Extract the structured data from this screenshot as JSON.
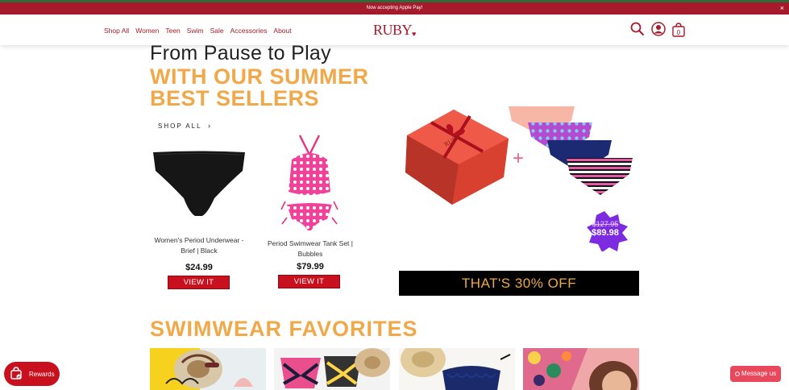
{
  "announcement": {
    "text": "Now accepting Apple Pay!",
    "close_icon": "×"
  },
  "nav": {
    "items": [
      {
        "label": "Shop All"
      },
      {
        "label": "Women"
      },
      {
        "label": "Teen"
      },
      {
        "label": "Swim"
      },
      {
        "label": "Sale"
      },
      {
        "label": "Accessories"
      },
      {
        "label": "About"
      }
    ]
  },
  "logo": {
    "text": "RUBY",
    "mark": "♥"
  },
  "cart": {
    "count": "0"
  },
  "hero": {
    "line1": "From Pause to Play",
    "line2": "WITH OUR SUMMER",
    "line3": "BEST SELLERS",
    "shop_all": "SHOP ALL",
    "chevron": "›"
  },
  "products": [
    {
      "name": "Women's Period Underwear - Brief | Black",
      "price": "$24.99",
      "button": "VIEW IT"
    },
    {
      "name": "Period Swimwear Tank Set | Bubbles",
      "price": "$79.99",
      "button": "VIEW IT"
    }
  ],
  "promo": {
    "box_text": "RUBY",
    "plus": "+",
    "old_price": "$127.95",
    "new_price": "$89.98",
    "banner": "THAT'S 30% OFF"
  },
  "section": {
    "title": "SWIMWEAR FAVORITES"
  },
  "rewards": {
    "label": "Rewards"
  },
  "message": {
    "label": "Message us"
  },
  "colors": {
    "brand": "#a51b2c",
    "accent": "#f0a848",
    "button": "#c8101e",
    "badge": "#7d2be0"
  }
}
